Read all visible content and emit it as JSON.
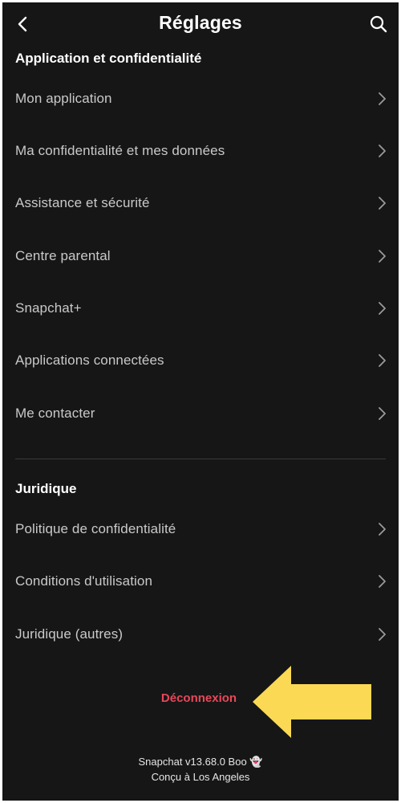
{
  "header": {
    "title": "Réglages"
  },
  "sections": [
    {
      "title": "Application et confidentialité",
      "items": [
        {
          "label": "Mon application"
        },
        {
          "label": "Ma confidentialité et mes données"
        },
        {
          "label": "Assistance et sécurité"
        },
        {
          "label": "Centre parental"
        },
        {
          "label": "Snapchat+"
        },
        {
          "label": "Applications connectées"
        },
        {
          "label": "Me contacter"
        }
      ]
    },
    {
      "title": "Juridique",
      "items": [
        {
          "label": "Politique de confidentialité"
        },
        {
          "label": "Conditions d'utilisation"
        },
        {
          "label": "Juridique (autres)"
        }
      ]
    }
  ],
  "logout": {
    "label": "Déconnexion"
  },
  "footer": {
    "version": "Snapchat v13.68.0 Boo 👻",
    "made_in": "Conçu à Los Angeles"
  },
  "colors": {
    "background": "#161616",
    "logout": "#e8485a",
    "arrow": "#fcd954"
  }
}
